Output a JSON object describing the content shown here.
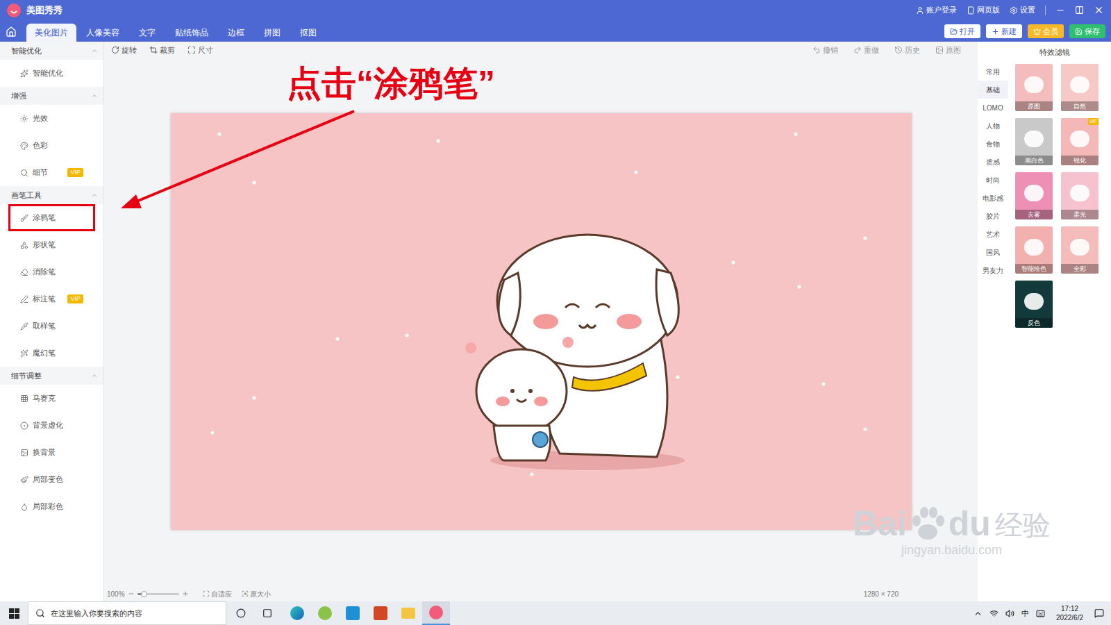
{
  "window": {
    "title": "美图秀秀",
    "links": [
      "账户登录",
      "网页版",
      "设置"
    ]
  },
  "tabs": [
    {
      "label": "美化图片",
      "selected": true
    },
    {
      "label": "人像美容",
      "selected": false
    },
    {
      "label": "文字",
      "selected": false
    },
    {
      "label": "贴纸饰品",
      "selected": false
    },
    {
      "label": "边框",
      "selected": false
    },
    {
      "label": "拼图",
      "selected": false
    },
    {
      "label": "抠图",
      "selected": false
    }
  ],
  "actions": [
    {
      "label": "打开",
      "kind": "plain"
    },
    {
      "label": "新建",
      "kind": "plain"
    },
    {
      "label": "会员",
      "kind": "vip"
    },
    {
      "label": "保存",
      "kind": "save"
    }
  ],
  "sidebar": {
    "sections": [
      {
        "title": "智能优化",
        "expanded": true,
        "items": [
          {
            "label": "智能优化",
            "vip": false,
            "highlighted": false
          }
        ]
      },
      {
        "title": "增强",
        "expanded": true,
        "items": [
          {
            "label": "光效",
            "vip": false,
            "highlighted": false
          },
          {
            "label": "色彩",
            "vip": false,
            "highlighted": false
          },
          {
            "label": "细节",
            "vip": true,
            "highlighted": false
          }
        ]
      },
      {
        "title": "画笔工具",
        "expanded": true,
        "items": [
          {
            "label": "涂鸦笔",
            "vip": false,
            "highlighted": true
          },
          {
            "label": "形状笔",
            "vip": false,
            "highlighted": false
          },
          {
            "label": "消除笔",
            "vip": false,
            "highlighted": false
          },
          {
            "label": "标注笔",
            "vip": true,
            "highlighted": false
          },
          {
            "label": "取样笔",
            "vip": false,
            "highlighted": false
          },
          {
            "label": "魔幻笔",
            "vip": false,
            "highlighted": false
          }
        ]
      },
      {
        "title": "细节调整",
        "expanded": true,
        "items": [
          {
            "label": "马赛克",
            "vip": false,
            "highlighted": false
          },
          {
            "label": "背景虚化",
            "vip": false,
            "highlighted": false
          },
          {
            "label": "换背景",
            "vip": false,
            "highlighted": false
          },
          {
            "label": "局部变色",
            "vip": false,
            "highlighted": false
          },
          {
            "label": "局部彩色",
            "vip": false,
            "highlighted": false
          }
        ]
      }
    ]
  },
  "vip_badge": "VIP",
  "toolbar": {
    "left": [
      "旋转",
      "裁剪",
      "尺寸"
    ],
    "right": [
      "撤销",
      "重做",
      "历史",
      "原图"
    ]
  },
  "zoom": {
    "value": "100%",
    "level": 0.15,
    "buttons": [
      "自适应",
      "原大小"
    ],
    "size": "1280 × 720"
  },
  "filters": {
    "title": "特效滤镜",
    "categories": [
      {
        "label": "常用",
        "selected": false
      },
      {
        "label": "基础",
        "selected": true
      },
      {
        "label": "LOMO",
        "selected": false
      },
      {
        "label": "人物",
        "selected": false
      },
      {
        "label": "食物",
        "selected": false
      },
      {
        "label": "质感",
        "selected": false
      },
      {
        "label": "时尚",
        "selected": false
      },
      {
        "label": "电影感",
        "selected": false
      },
      {
        "label": "胶片",
        "selected": false
      },
      {
        "label": "艺术",
        "selected": false
      },
      {
        "label": "国风",
        "selected": false
      },
      {
        "label": "男友力",
        "selected": false
      }
    ],
    "items": [
      {
        "label": "原图",
        "vip": false,
        "color": "#f4bcbc"
      },
      {
        "label": "自然",
        "vip": false,
        "color": "#f7c9c6"
      },
      {
        "label": "黑白色",
        "vip": false,
        "color": "#c9c9c9"
      },
      {
        "label": "锐化",
        "vip": true,
        "color": "#f5b8b8"
      },
      {
        "label": "去雾",
        "vip": false,
        "color": "#ee8fb5"
      },
      {
        "label": "柔光",
        "vip": false,
        "color": "#f6c2cf"
      },
      {
        "label": "智能绘色",
        "vip": false,
        "color": "#f2b0ae"
      },
      {
        "label": "全彩",
        "vip": false,
        "color": "#f5bcbc"
      },
      {
        "label": "反色",
        "vip": false,
        "color": "#123a3a"
      }
    ]
  },
  "annotation": {
    "text": "点击“涂鸦笔”"
  },
  "watermark": {
    "left": "Bai",
    "right": "du",
    "cn": "经验",
    "url": "jingyan.baidu.com"
  },
  "taskbar": {
    "search": "在这里输入你要搜索的内容",
    "ime": "中",
    "time": "17:12",
    "date": "2022/6/2"
  }
}
